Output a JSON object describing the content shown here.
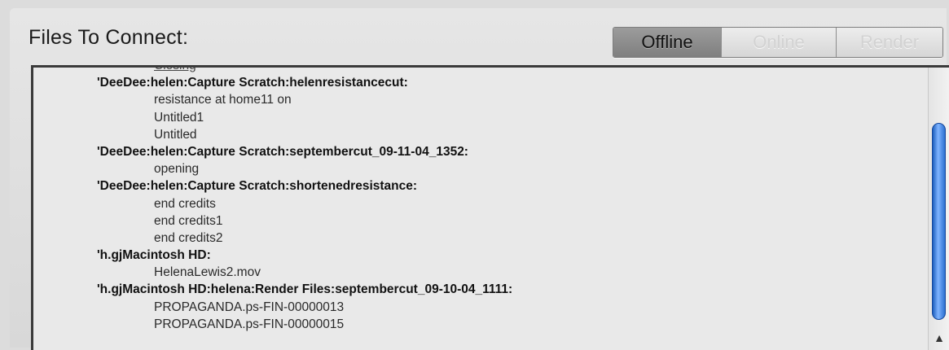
{
  "header": {
    "title": "Files To Connect:",
    "tabs": [
      {
        "label": "Offline",
        "active": true
      },
      {
        "label": "Online",
        "active": false
      },
      {
        "label": "Render",
        "active": false
      }
    ]
  },
  "file_list": {
    "rows": [
      {
        "text": "Closing",
        "kind": "partial"
      },
      {
        "text": "'DeeDee:helen:Capture Scratch:helenresistancecut:",
        "kind": "path"
      },
      {
        "text": "resistance at home11 on",
        "kind": "file"
      },
      {
        "text": "Untitled1",
        "kind": "file"
      },
      {
        "text": "Untitled",
        "kind": "file"
      },
      {
        "text": "'DeeDee:helen:Capture Scratch:septembercut_09-11-04_1352:",
        "kind": "path"
      },
      {
        "text": "opening",
        "kind": "file"
      },
      {
        "text": "'DeeDee:helen:Capture Scratch:shortenedresistance:",
        "kind": "path"
      },
      {
        "text": "end credits",
        "kind": "file"
      },
      {
        "text": "end credits1",
        "kind": "file"
      },
      {
        "text": "end credits2",
        "kind": "file"
      },
      {
        "text": "'h.gjMacintosh HD:",
        "kind": "path"
      },
      {
        "text": "HelenaLewis2.mov",
        "kind": "file"
      },
      {
        "text": "'h.gjMacintosh HD:helena:Render Files:septembercut_09-10-04_1111:",
        "kind": "path"
      },
      {
        "text": "PROPAGANDA.ps-FIN-00000013",
        "kind": "file"
      },
      {
        "text": "PROPAGANDA.ps-FIN-00000015",
        "kind": "file"
      }
    ]
  },
  "scrollbar": {
    "up_arrow": "▲",
    "thumb_color": "#2a6fd1"
  }
}
